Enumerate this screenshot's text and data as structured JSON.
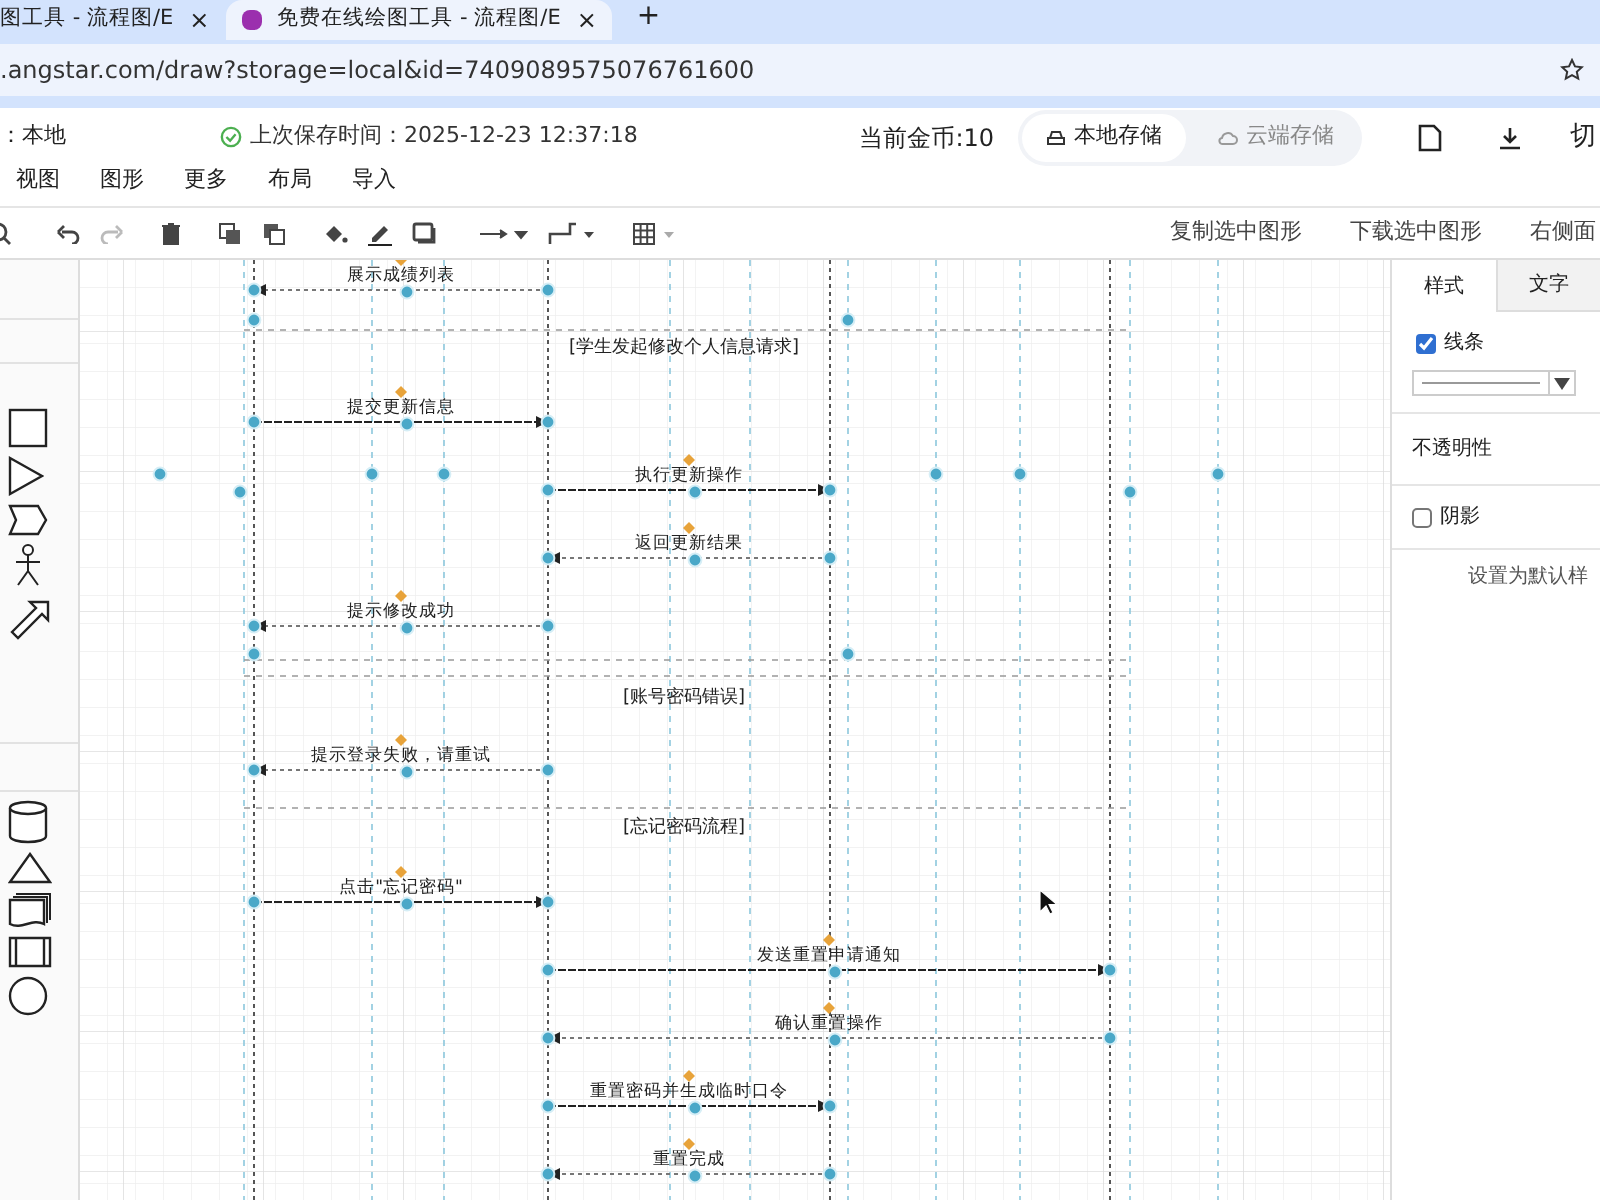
{
  "browser": {
    "tabs": [
      {
        "title": "图工具 - 流程图/E",
        "close": "×",
        "selected": false
      },
      {
        "title": "免费在线绘图工具 - 流程图/E",
        "close": "×",
        "selected": true
      }
    ],
    "new_tab": "+",
    "url": ".angstar.com/draw?storage=local&id=7409089575076761600"
  },
  "header": {
    "storage": "：本地",
    "save_status": "上次保存时间：2025-12-23 12:37:18",
    "coins": "当前金币:10",
    "storage_buttons": [
      {
        "label": "本地存储",
        "selected": true
      },
      {
        "label": "云端存储",
        "selected": false
      }
    ],
    "cut_label": "切"
  },
  "menu": [
    "视图",
    "图形",
    "更多",
    "布局",
    "导入"
  ],
  "toolbar_actions": [
    "复制选中图形",
    "下载选中图形",
    "右侧面"
  ],
  "diagram": [
    {
      "kind": "return",
      "label": "展示成绩列表"
    },
    {
      "kind": "guard",
      "label": "[学生发起修改个人信息请求]"
    },
    {
      "kind": "call",
      "label": "提交更新信息"
    },
    {
      "kind": "call",
      "label": "执行更新操作"
    },
    {
      "kind": "return",
      "label": "返回更新结果"
    },
    {
      "kind": "return",
      "label": "提示修改成功"
    },
    {
      "kind": "guard",
      "label": "[账号密码错误]"
    },
    {
      "kind": "return",
      "label": "提示登录失败，请重试"
    },
    {
      "kind": "guard",
      "label": "[忘记密码流程]"
    },
    {
      "kind": "call",
      "label": "点击\"忘记密码\""
    },
    {
      "kind": "call",
      "label": "发送重置申请通知"
    },
    {
      "kind": "return",
      "label": "确认重置操作"
    },
    {
      "kind": "call",
      "label": "重置密码并生成临时口令"
    },
    {
      "kind": "return",
      "label": "重置完成"
    }
  ],
  "format_panel": {
    "tabs": [
      {
        "label": "样式",
        "selected": true
      },
      {
        "label": "文字",
        "selected": false
      }
    ],
    "line": {
      "label": "线条",
      "checked": true
    },
    "opacity_label": "不透明性",
    "shadow": {
      "label": "阴影",
      "checked": false
    },
    "default_label": "设置为默认样"
  }
}
